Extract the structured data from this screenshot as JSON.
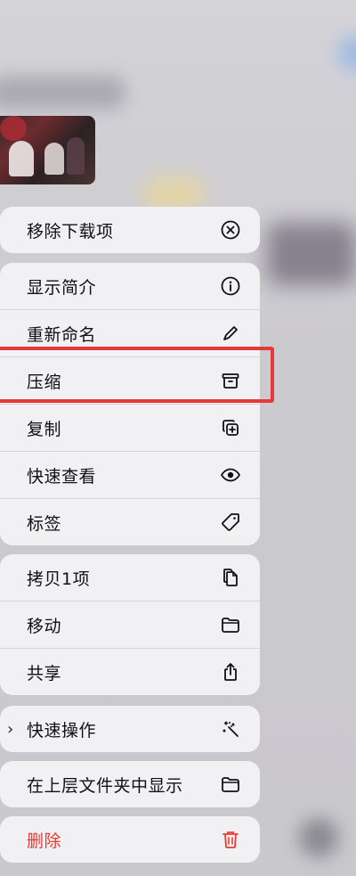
{
  "menu": {
    "groups": [
      {
        "items": [
          {
            "label": "移除下载项",
            "icon": "remove-download-icon"
          }
        ]
      },
      {
        "items": [
          {
            "label": "显示简介",
            "icon": "info-icon"
          },
          {
            "label": "重新命名",
            "icon": "pencil-icon"
          },
          {
            "label": "压缩",
            "icon": "archive-box-icon"
          },
          {
            "label": "复制",
            "icon": "duplicate-icon"
          },
          {
            "label": "快速查看",
            "icon": "eye-icon"
          },
          {
            "label": "标签",
            "icon": "tag-icon"
          }
        ]
      },
      {
        "items": [
          {
            "label": "拷贝1项",
            "icon": "copy-doc-icon"
          },
          {
            "label": "移动",
            "icon": "folder-icon"
          },
          {
            "label": "共享",
            "icon": "share-icon"
          }
        ]
      },
      {
        "items": [
          {
            "label": "快速操作",
            "icon": "magic-wand-icon"
          }
        ]
      },
      {
        "items": [
          {
            "label": "在上层文件夹中显示",
            "icon": "folder-icon"
          }
        ]
      },
      {
        "items": [
          {
            "label": "删除",
            "icon": "trash-icon"
          }
        ]
      }
    ]
  },
  "colors": {
    "highlight": "#e53935",
    "danger": "#ea3b32",
    "menu_bg": "#f1f0f3"
  }
}
